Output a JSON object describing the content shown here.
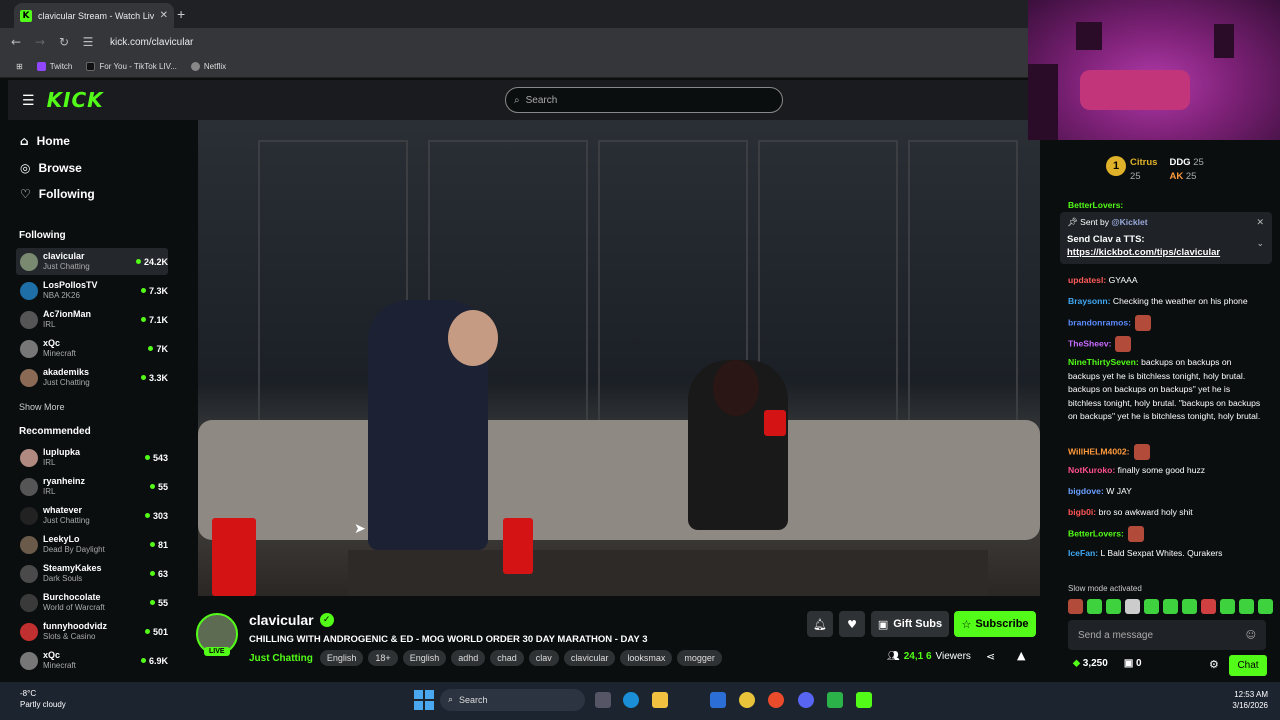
{
  "browser": {
    "tab_title": "clavicular Stream - Watch Live on Kick",
    "url": "kick.com/clavicular",
    "bookmarks": [
      {
        "label": "Twitch",
        "color": "#9146ff"
      },
      {
        "label": "For You - TikTok LIV...",
        "color": "#111111"
      },
      {
        "label": "Netflix",
        "color": "#888888"
      }
    ]
  },
  "site": {
    "logo": "KICK",
    "search_placeholder": "Search",
    "nav": [
      {
        "label": "Home",
        "icon": "home-icon"
      },
      {
        "label": "Browse",
        "icon": "browse-icon"
      },
      {
        "label": "Following",
        "icon": "heart-icon"
      }
    ],
    "following_title": "Following",
    "following": [
      {
        "name": "clavicular",
        "cat": "Just Chatting",
        "viewers": "24.2K",
        "color": "#7a8a70",
        "active": true
      },
      {
        "name": "LosPollosTV",
        "cat": "NBA 2K26",
        "viewers": "7.3K",
        "color": "#1e6fa8"
      },
      {
        "name": "Ac7ionMan",
        "cat": "IRL",
        "viewers": "7.1K",
        "color": "#555555"
      },
      {
        "name": "xQc",
        "cat": "Minecraft",
        "viewers": "7K",
        "color": "#777777"
      },
      {
        "name": "akademiks",
        "cat": "Just Chatting",
        "viewers": "3.3K",
        "color": "#8a6a55"
      }
    ],
    "show_more": "Show More",
    "recommended_title": "Recommended",
    "recommended": [
      {
        "name": "luplupka",
        "cat": "IRL",
        "viewers": "543",
        "color": "#b08a80"
      },
      {
        "name": "ryanheinz",
        "cat": "IRL",
        "viewers": "55",
        "color": "#555555"
      },
      {
        "name": "whatever",
        "cat": "Just Chatting",
        "viewers": "303",
        "color": "#222222"
      },
      {
        "name": "LeekyLo",
        "cat": "Dead By Daylight",
        "viewers": "81",
        "color": "#6a5a4a"
      },
      {
        "name": "SteamyKakes",
        "cat": "Dark Souls",
        "viewers": "63",
        "color": "#4a4a4a"
      },
      {
        "name": "Burchocolate",
        "cat": "World of Warcraft",
        "viewers": "55",
        "color": "#3a3a3a"
      },
      {
        "name": "funnyhoodvidz",
        "cat": "Slots & Casino",
        "viewers": "501",
        "color": "#c03030"
      },
      {
        "name": "xQc",
        "cat": "Minecraft",
        "viewers": "6.9K",
        "color": "#777777"
      }
    ]
  },
  "stream": {
    "name": "clavicular",
    "live": "LIVE",
    "title": "CHILLING WITH ANDROGENIC & ED - MOG WORLD ORDER 30 DAY MARATHON - DAY 3",
    "category": "Just Chatting",
    "tags": [
      "English",
      "18+",
      "English",
      "adhd",
      "chad",
      "clav",
      "clavicular",
      "looksmax",
      "mogger"
    ],
    "gift_label": "Gift Subs",
    "subscribe_label": "Subscribe",
    "viewers": "24,1 6",
    "viewers_label": "Viewers"
  },
  "chat": {
    "leaderboard": [
      {
        "rank": "1",
        "name": "Citrus",
        "count": "25"
      },
      {
        "name": "DDG",
        "count": "25"
      },
      {
        "name": "AK",
        "count": "25"
      }
    ],
    "pinned": {
      "sent_by": "Sent by",
      "sender": "@Kicklet",
      "line1": "Send Clav a TTS:",
      "link": "https://kickbot.com/tips/clavicular"
    },
    "top_partial": "BetterLovers:",
    "messages": [
      {
        "user": "updatesl:",
        "color": "#ff5a5a",
        "text": "GYAAA"
      },
      {
        "user": "Braysonn:",
        "color": "#3fa9f5",
        "text": "Checking the weather on his phone"
      },
      {
        "user": "brandonramos:",
        "color": "#5b8cff",
        "text": ""
      },
      {
        "user": "TheSheev:",
        "color": "#c76bff",
        "text": ""
      },
      {
        "user": "NineThirtySeven:",
        "color": "#53fc18",
        "text": "backups on backups on backups yet he is bitchless tonight, holy brutal. backups on backups on backups\" yet he is bitchless tonight, holy brutal. \"backups on backups on backups\" yet he is bitchless tonight, holy brutal."
      },
      {
        "user": "WillHELM4002:",
        "color": "#ff9a3c",
        "text": ""
      },
      {
        "user": "NotKuroko:",
        "color": "#ff4f8a",
        "text": "finally some good huzz"
      },
      {
        "user": "bigdove:",
        "color": "#6aa0ff",
        "text": "W JAY"
      },
      {
        "user": "bigb0i:",
        "color": "#ff5555",
        "text": "bro so awkward holy shit"
      },
      {
        "user": "BetterLovers:",
        "color": "#53fc18",
        "text": ""
      },
      {
        "user": "IceFan:",
        "color": "#3fa9f5",
        "text": "L Bald Sexpat Whites.  Qurakers"
      }
    ],
    "slow_mode": "Slow mode activated",
    "input_placeholder": "Send a message",
    "points": "3,250",
    "gift_count": "0",
    "chat_button": "Chat"
  },
  "taskbar": {
    "temp": "-8°C",
    "weather": "Partly cloudy",
    "search_placeholder": "Search",
    "time": "12:53 AM",
    "date": "3/16/2026"
  }
}
